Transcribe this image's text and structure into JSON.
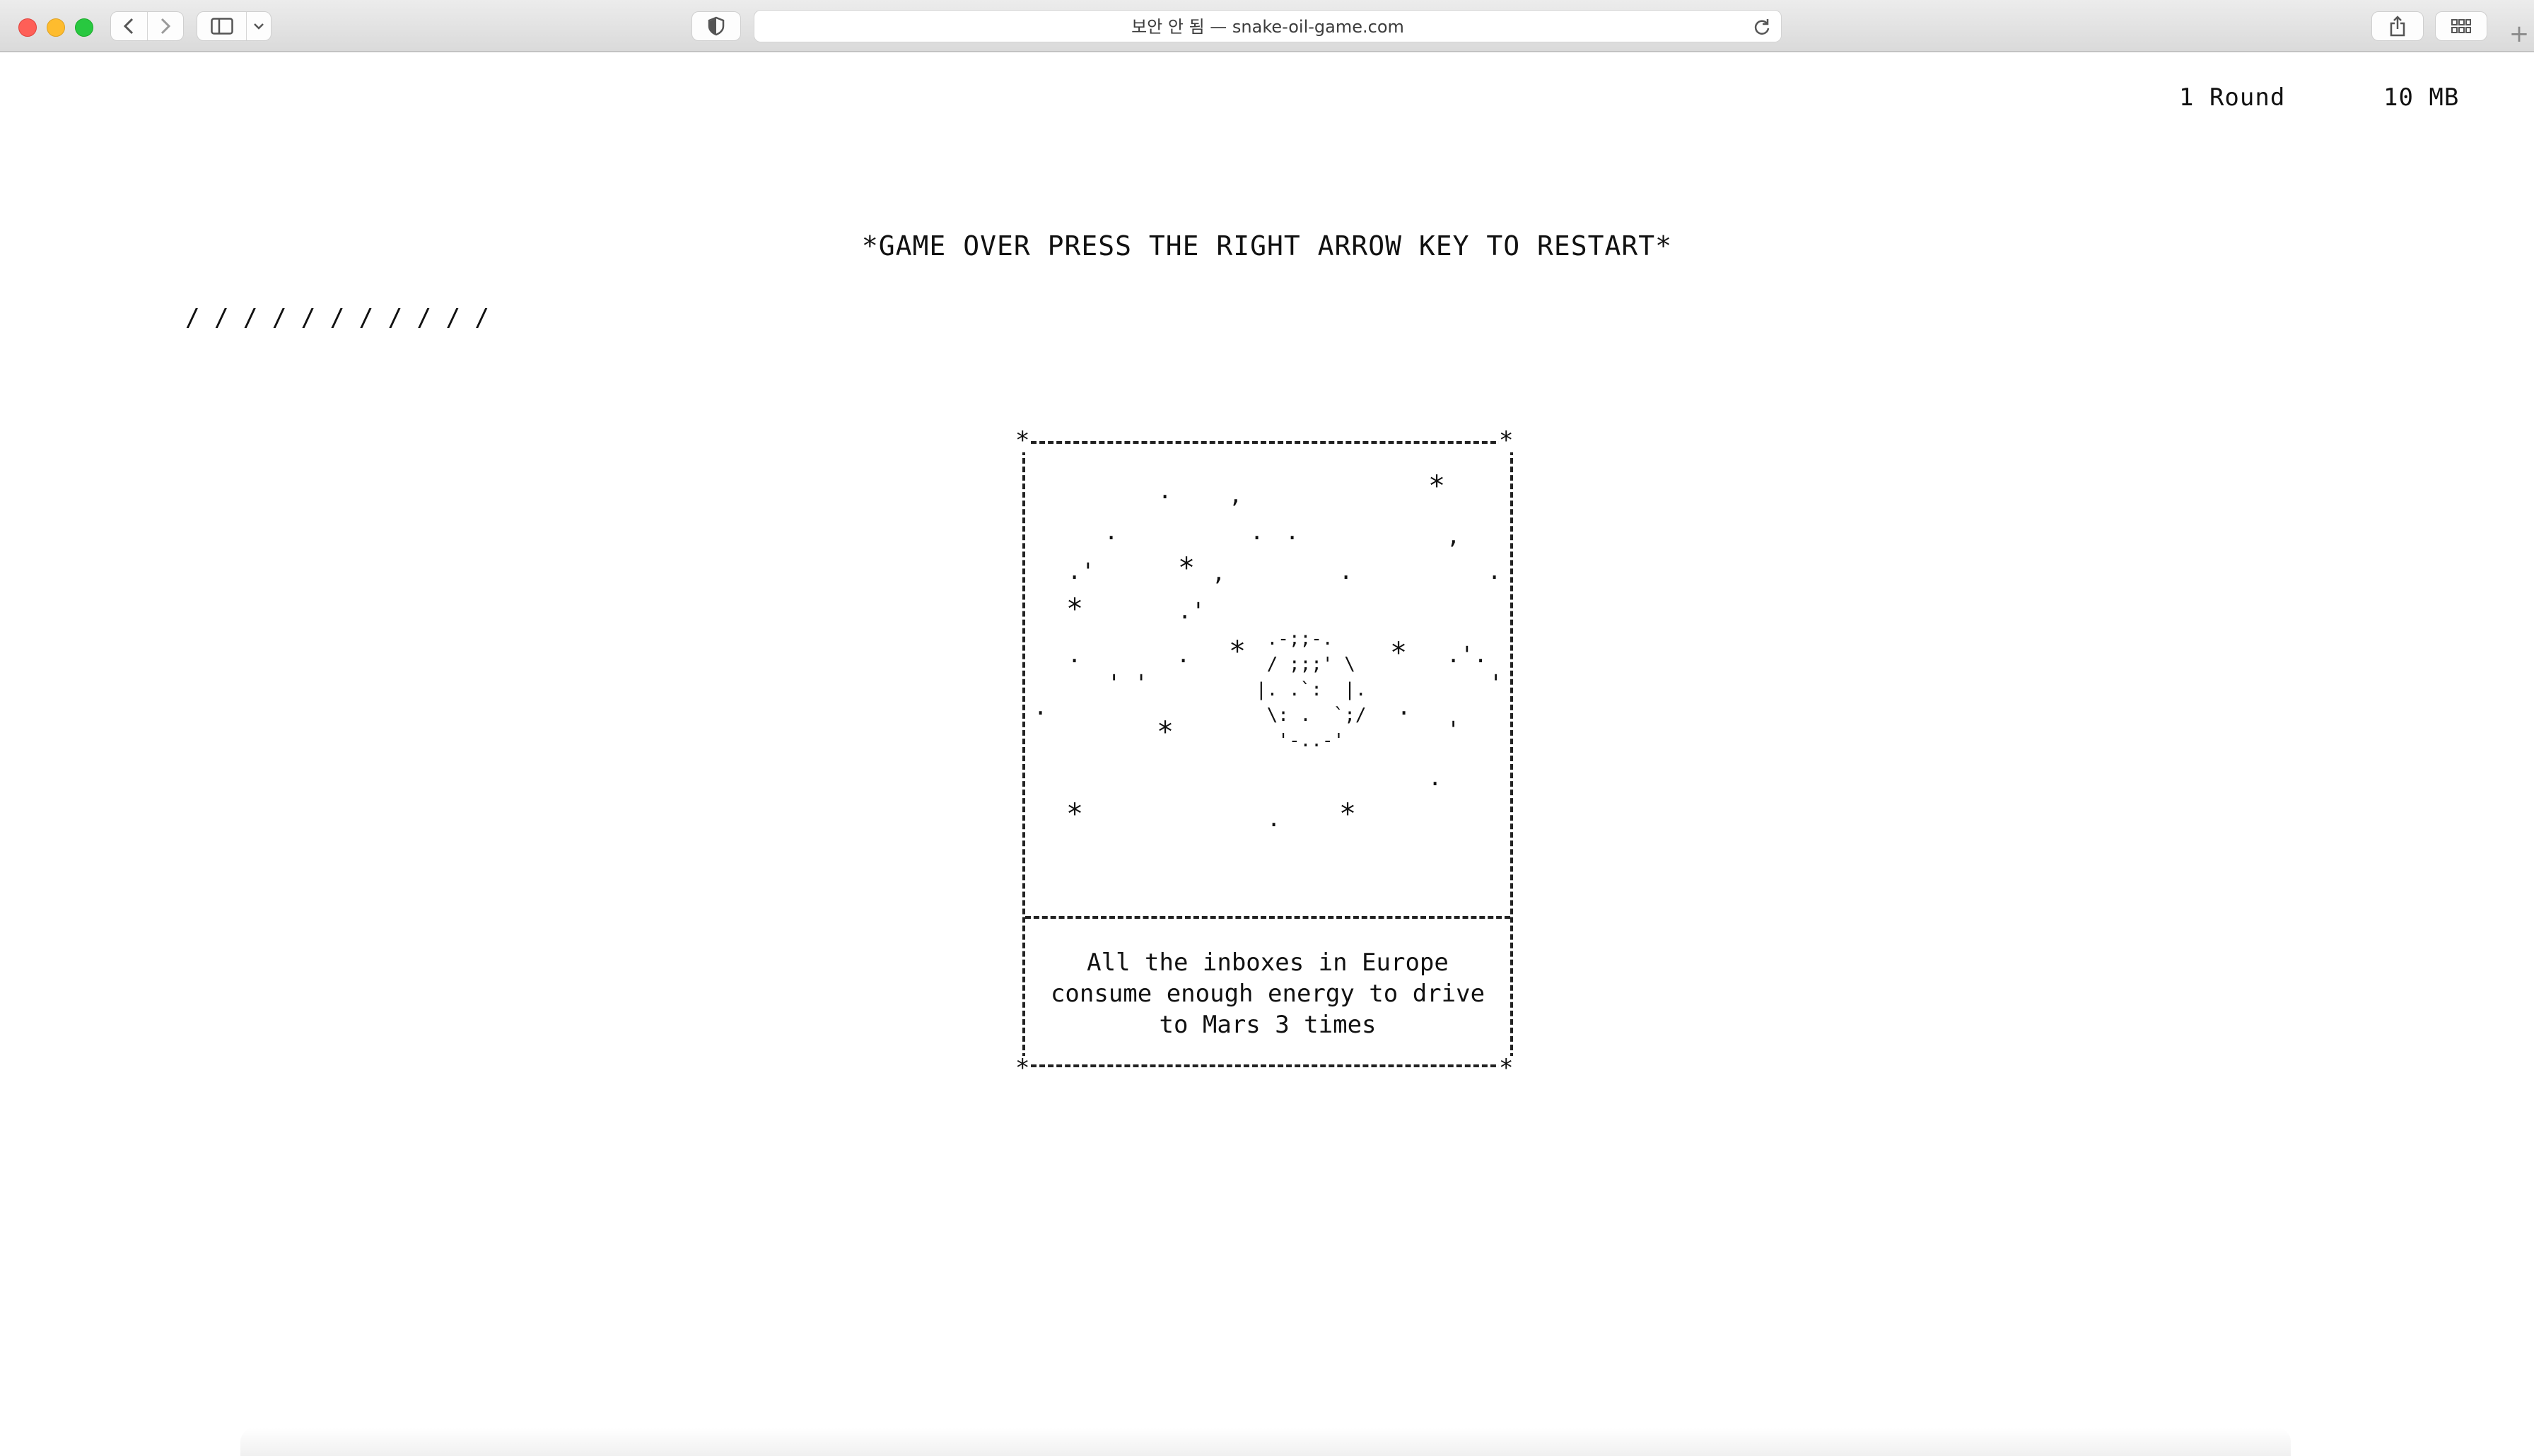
{
  "browser": {
    "address_text": "보안 안 됨 — snake-oil-game.com",
    "icons": [
      "back-arrow-icon",
      "forward-arrow-icon",
      "sidebar-icon",
      "chevron-down-icon",
      "privacy-shield-icon",
      "reload-icon",
      "share-icon",
      "tab-overview-icon",
      "plus-icon"
    ],
    "new_tab_label": "+"
  },
  "game": {
    "round": "1 Round",
    "size": "10 MB",
    "status": "*GAME OVER PRESS THE RIGHT ARROW KEY TO RESTART*",
    "lives": "/ / / / / / / / / / /",
    "card": {
      "corner_symbol": "*",
      "caption_line1": "All the inboxes in Europe",
      "caption_line2": "consume enough energy to drive",
      "caption_line3": "to Mars 3 times"
    }
  }
}
